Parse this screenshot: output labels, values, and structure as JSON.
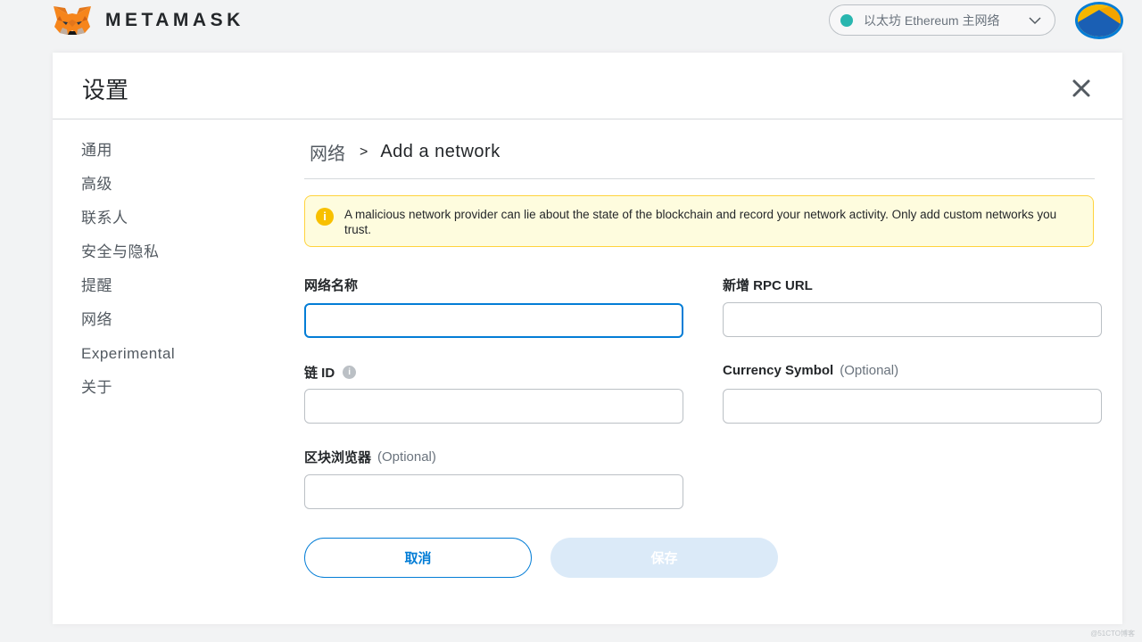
{
  "header": {
    "brand": "METAMASK",
    "network_label": "以太坊 Ethereum 主网络",
    "network_dot_color": "#29b6af"
  },
  "settings": {
    "title": "设置",
    "close_icon": "close-icon"
  },
  "sidebar": {
    "items": [
      {
        "label": "通用"
      },
      {
        "label": "高级"
      },
      {
        "label": "联系人"
      },
      {
        "label": "安全与隐私"
      },
      {
        "label": "提醒"
      },
      {
        "label": "网络"
      },
      {
        "label": "Experimental"
      },
      {
        "label": "关于"
      }
    ]
  },
  "breadcrumb": {
    "parent": "网络",
    "separator": ">",
    "current": "Add a network"
  },
  "warning": {
    "text": "A malicious network provider can lie about the state of the blockchain and record your network activity. Only add custom networks you trust."
  },
  "form": {
    "network_name": {
      "label": "网络名称",
      "value": ""
    },
    "rpc_url": {
      "label": "新增 RPC URL",
      "value": ""
    },
    "chain_id": {
      "label": "链 ID",
      "value": ""
    },
    "currency_symbol": {
      "label": "Currency Symbol",
      "optional": "(Optional)",
      "value": ""
    },
    "explorer": {
      "label": "区块浏览器",
      "optional": "(Optional)",
      "value": ""
    }
  },
  "buttons": {
    "cancel": "取消",
    "save": "保存"
  },
  "colors": {
    "accent": "#037dd6",
    "warning_bg": "#fefcde",
    "warning_border": "#ffd33d",
    "save_disabled": "#dbeaf8"
  },
  "watermark": "@51CTO博客"
}
